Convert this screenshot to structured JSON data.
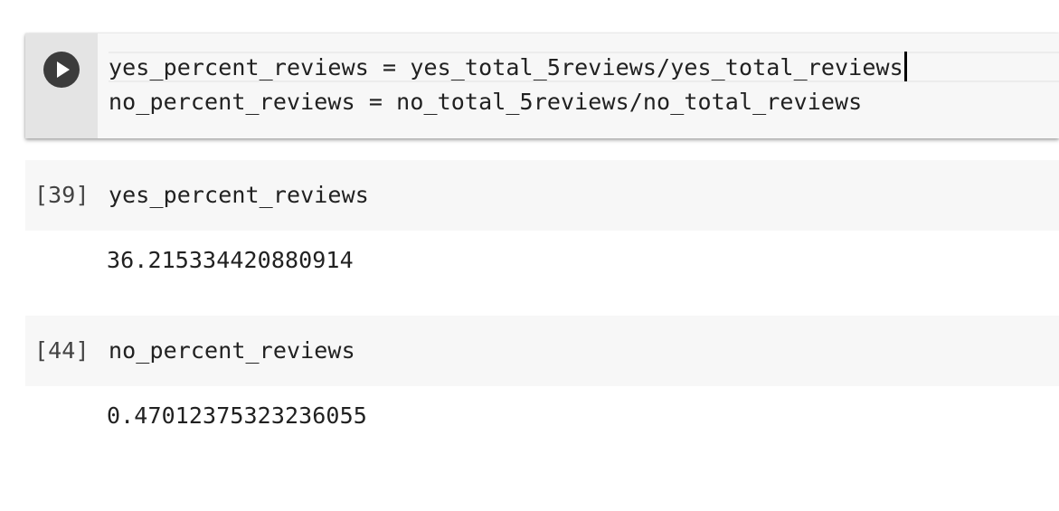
{
  "active_cell": {
    "run_icon": "play-icon",
    "lines": [
      "yes_percent_reviews = yes_total_5reviews/yes_total_reviews",
      "no_percent_reviews = no_total_5reviews/no_total_reviews"
    ]
  },
  "cells": [
    {
      "execution_count": "[39]",
      "code": "yes_percent_reviews",
      "output": "36.215334420880914"
    },
    {
      "execution_count": "[44]",
      "code": "no_percent_reviews",
      "output": "0.47012375323236055"
    }
  ]
}
